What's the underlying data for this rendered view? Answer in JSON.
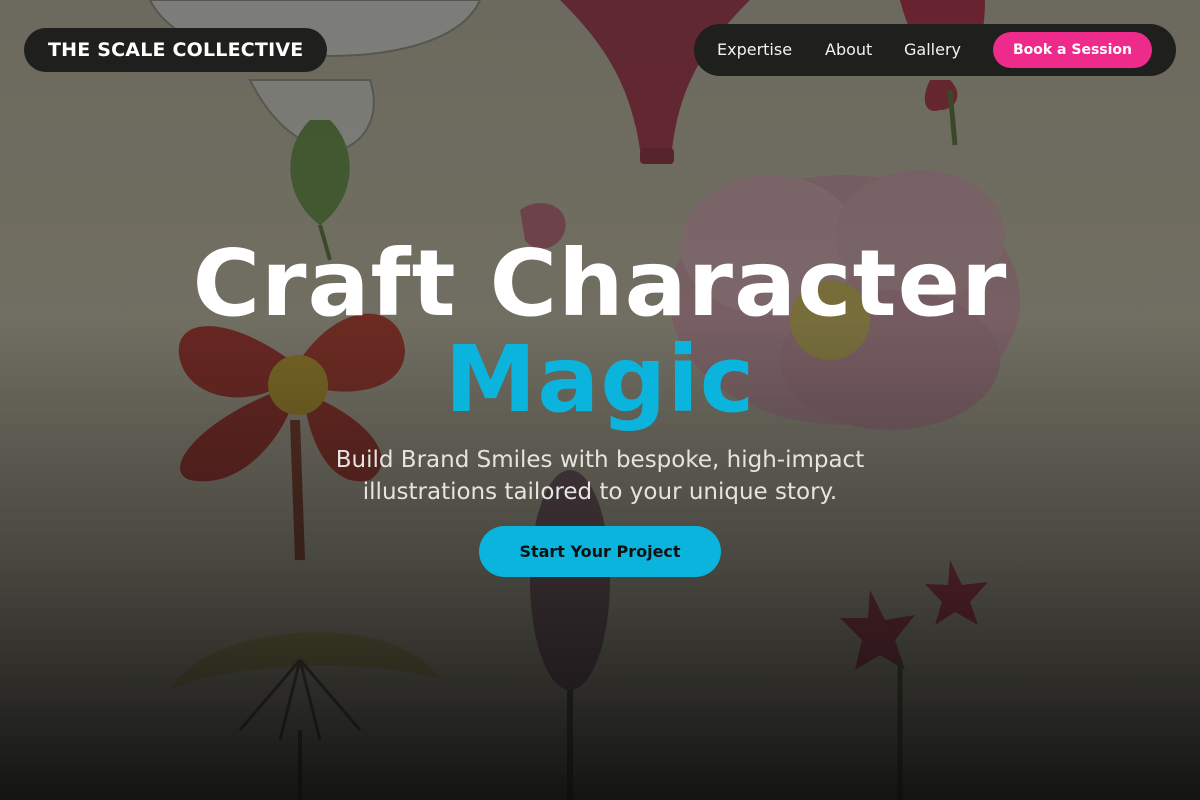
{
  "brand": {
    "name": "THE SCALE COLLECTIVE"
  },
  "nav": {
    "links": [
      {
        "label": "Expertise"
      },
      {
        "label": "About"
      },
      {
        "label": "Gallery"
      }
    ],
    "cta_label": "Book a Session"
  },
  "hero": {
    "headline_line1": "Craft Character",
    "headline_line2": "Magic",
    "subheadline": "Build Brand Smiles with bespoke, high-impact illustrations tailored to your unique story.",
    "cta_label": "Start Your Project",
    "background_subject": "botanical-flower-illustrations"
  },
  "colors": {
    "accent_cyan": "#0bb4dd",
    "accent_pink": "#ee2a8a",
    "pill_dark": "#1f1f1d",
    "text_white": "#ffffff"
  }
}
